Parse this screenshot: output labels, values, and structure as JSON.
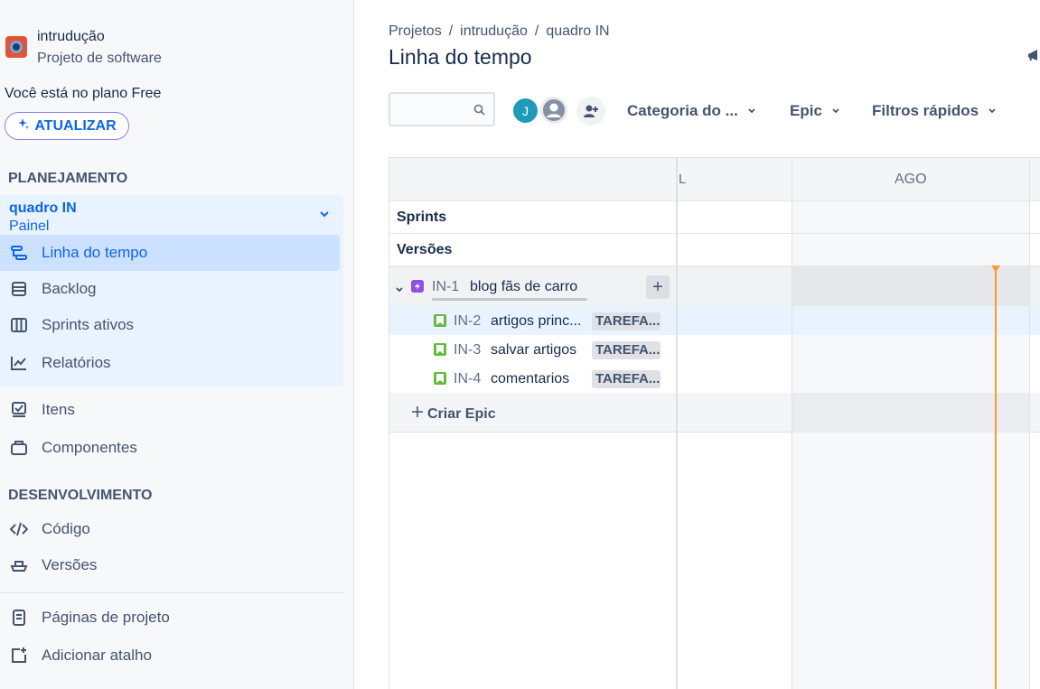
{
  "sidebar": {
    "project_name": "intrudução",
    "project_type": "Projeto de software",
    "plan_text": "Você está no plano Free",
    "upgrade_label": "ATUALIZAR",
    "section_planning": "PLANEJAMENTO",
    "board_name": "quadro IN",
    "board_sub": "Painel",
    "planning_items": [
      {
        "label": "Linha do tempo",
        "icon": "timeline-icon",
        "active": true
      },
      {
        "label": "Backlog",
        "icon": "backlog-icon",
        "active": false
      },
      {
        "label": "Sprints ativos",
        "icon": "board-columns-icon",
        "active": false
      },
      {
        "label": "Relatórios",
        "icon": "reports-icon",
        "active": false
      }
    ],
    "other_items": [
      {
        "label": "Itens",
        "icon": "issues-icon"
      },
      {
        "label": "Componentes",
        "icon": "components-icon"
      }
    ],
    "section_dev": "DESENVOLVIMENTO",
    "dev_items": [
      {
        "label": "Código",
        "icon": "code-icon"
      },
      {
        "label": "Versões",
        "icon": "ship-icon"
      }
    ],
    "footer_items": [
      {
        "label": "Páginas de projeto",
        "icon": "page-icon"
      },
      {
        "label": "Adicionar atalho",
        "icon": "add-shortcut-icon"
      }
    ]
  },
  "header": {
    "breadcrumbs": [
      "Projetos",
      "intrudução",
      "quadro IN"
    ],
    "separator": "/",
    "title": "Linha do tempo"
  },
  "toolbar": {
    "search_placeholder": "",
    "avatar_initial": "J",
    "filters": [
      {
        "label": "Categoria do ..."
      },
      {
        "label": "Epic"
      },
      {
        "label": "Filtros rápidos"
      }
    ]
  },
  "timeline": {
    "month_left": "L",
    "month_right": "AGO",
    "sprints_label": "Sprints",
    "versions_label": "Versões",
    "epic": {
      "key": "IN-1",
      "title": "blog fãs de carro"
    },
    "children": [
      {
        "key": "IN-2",
        "title": "artigos princ...",
        "status": "TAREFA..."
      },
      {
        "key": "IN-3",
        "title": "salvar artigos",
        "status": "TAREFA..."
      },
      {
        "key": "IN-4",
        "title": "comentarios",
        "status": "TAREFA..."
      }
    ],
    "create_epic_label": "Criar Epic"
  },
  "colors": {
    "accent": "#0c66e4",
    "today_marker": "#f79a33",
    "epic": "#904ee2",
    "story": "#63ba3c"
  }
}
